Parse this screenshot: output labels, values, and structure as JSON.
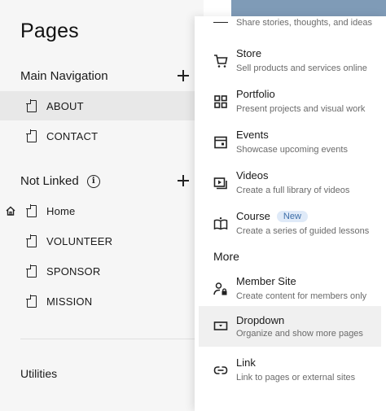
{
  "left": {
    "title": "Pages",
    "main_nav": {
      "heading": "Main Navigation"
    },
    "main_pages": [
      {
        "label": "ABOUT"
      },
      {
        "label": "CONTACT"
      }
    ],
    "not_linked": {
      "heading": "Not Linked",
      "info_glyph": "i"
    },
    "unlinked_pages": [
      {
        "label": "Home"
      },
      {
        "label": "VOLUNTEER"
      },
      {
        "label": "SPONSOR"
      },
      {
        "label": "MISSION"
      }
    ],
    "utilities": "Utilities"
  },
  "menu": {
    "partial_item_desc": "Share stories, thoughts, and ideas",
    "items": [
      {
        "name": "Store",
        "desc": "Sell products and services online",
        "icon": "cart-icon"
      },
      {
        "name": "Portfolio",
        "desc": "Present projects and visual work",
        "icon": "grid-icon"
      },
      {
        "name": "Events",
        "desc": "Showcase upcoming events",
        "icon": "calendar-icon"
      },
      {
        "name": "Videos",
        "desc": "Create a full library of videos",
        "icon": "video-icon"
      },
      {
        "name": "Course",
        "badge": "New",
        "desc": "Create a series of guided lessons",
        "icon": "book-icon"
      }
    ],
    "more_heading": "More",
    "more_items": [
      {
        "name": "Member Site",
        "desc": "Create content for members only",
        "icon": "member-icon"
      },
      {
        "name": "Dropdown",
        "desc": "Organize and show more pages",
        "icon": "dropdown-icon"
      },
      {
        "name": "Link",
        "desc": "Link to pages or external sites",
        "icon": "link-icon"
      }
    ]
  },
  "colors": {
    "panel_bg": "#f6f6f6",
    "active_row": "#e8e8e8",
    "badge_bg": "#dfeaf8",
    "badge_text": "#3d6ea8",
    "top_strip": "#7f9bb7"
  }
}
